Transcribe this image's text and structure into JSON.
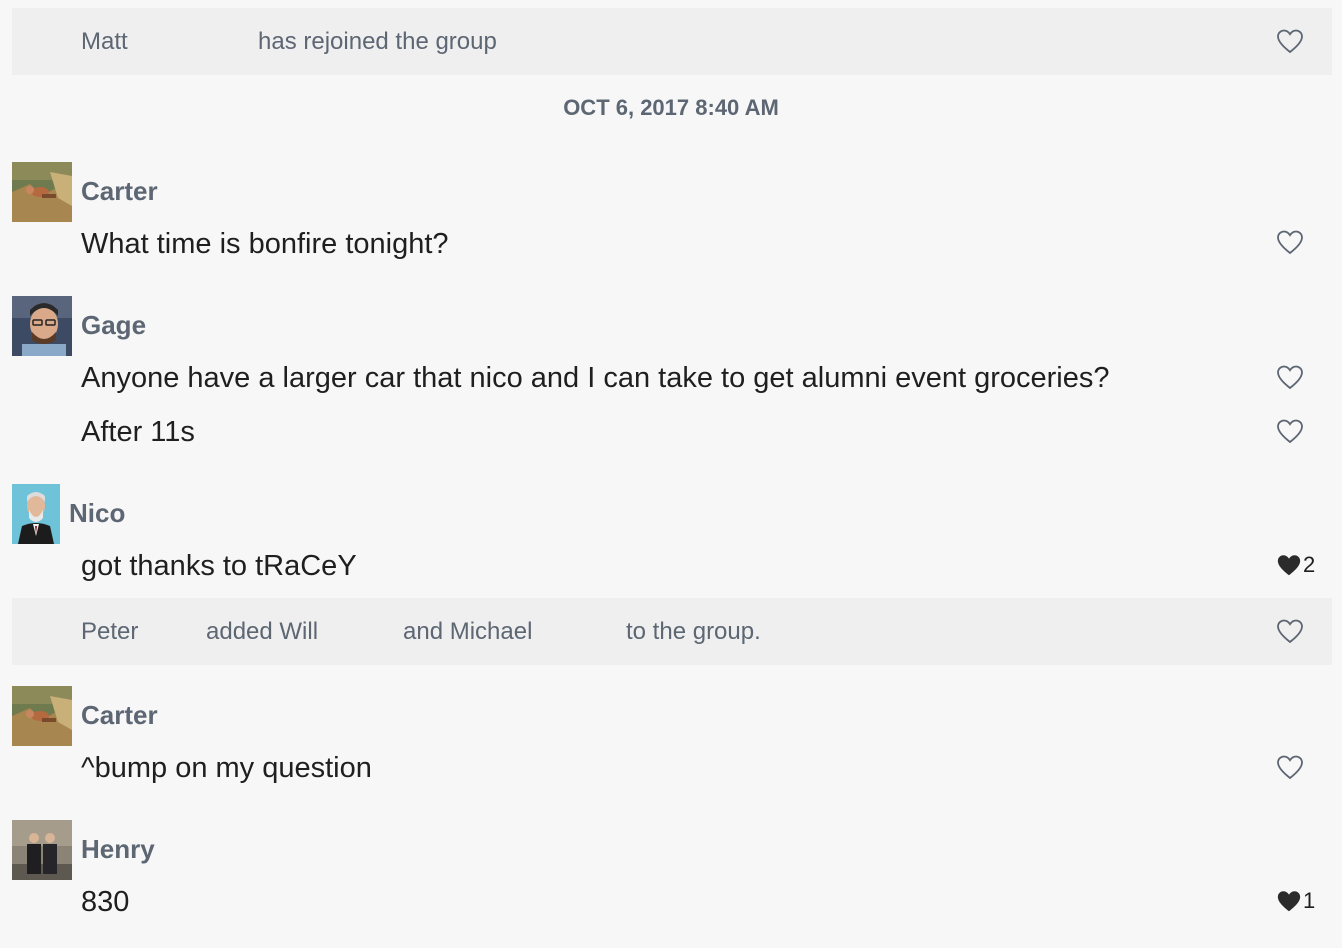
{
  "system_messages": [
    {
      "parts": [
        "Matt",
        "has rejoined the group"
      ]
    },
    {
      "parts": [
        "Peter",
        "added Will",
        "and Michael",
        "to the group."
      ]
    }
  ],
  "date_divider": "OCT 6, 2017 8:40 AM",
  "posts": [
    {
      "author": "Carter",
      "avatar": "carter-photo",
      "messages": [
        {
          "text": "What time is bonfire tonight?",
          "likes": "",
          "liked": false
        }
      ]
    },
    {
      "author": "Gage",
      "avatar": "gage-photo",
      "messages": [
        {
          "text": "Anyone have a larger car that nico and I can take to get alumni event groceries?",
          "likes": "",
          "liked": false
        },
        {
          "text": "After 11s",
          "likes": "",
          "liked": false
        }
      ]
    },
    {
      "author": "Nico",
      "avatar": "nico-photo",
      "messages": [
        {
          "text": "got thanks to tRaCeY",
          "likes": "2",
          "liked": true
        }
      ]
    },
    {
      "author": "Carter",
      "avatar": "carter-photo",
      "messages": [
        {
          "text": "^bump on my question",
          "likes": "",
          "liked": false
        }
      ]
    },
    {
      "author": "Henry",
      "avatar": "henry-photo",
      "messages": [
        {
          "text": "830",
          "likes": "1",
          "liked": true
        }
      ]
    }
  ],
  "icons": {
    "like_empty": "heart-outline-icon",
    "like_filled": "heart-filled-icon"
  },
  "colors": {
    "background": "#f7f7f7",
    "system_row": "#efefef",
    "muted_text": "#5d6673",
    "message_text": "#1f1f1f",
    "heart_outline": "#5d6673",
    "heart_filled": "#2b2b2b"
  }
}
